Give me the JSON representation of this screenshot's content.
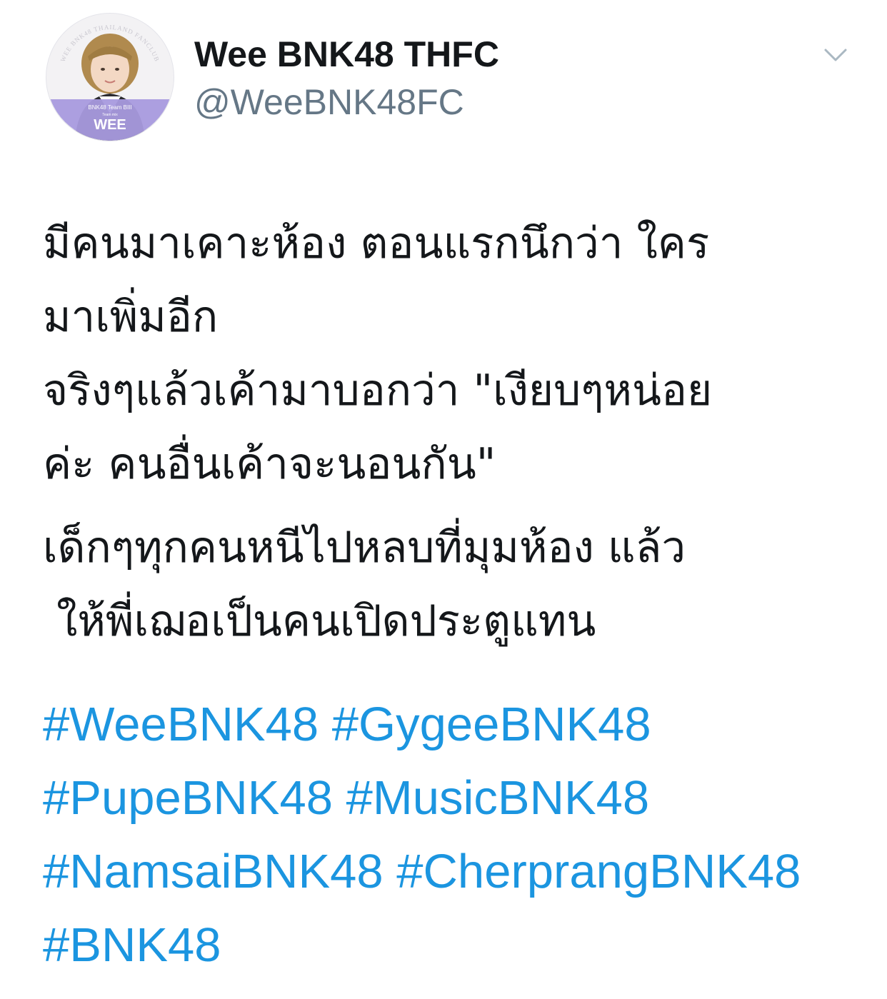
{
  "account": {
    "display_name": "Wee BNK48 THFC",
    "handle": "@WeeBNK48FC",
    "avatar": {
      "ring_text": "WEE BNK48 THAILAND FANCLUB",
      "badge_line1": "BNK48 Team BIII",
      "badge_line2": "Team mix",
      "badge_name": "WEE"
    },
    "menu_icon": "chevron-down-icon"
  },
  "tweet": {
    "paragraphs": [
      {
        "lines": [
          "มีคนมาเคาะห้อง ตอนแรกนึกว่า ใคร",
          "มาเพิ่มอีก",
          "จริงๆแล้วเค้ามาบอกว่า \"เงียบๆหน่อย",
          "ค่ะ คนอื่นเค้าจะนอนกัน\""
        ]
      },
      {
        "lines": [
          "เด็กๆทุกคนหนีไปหลบที่มุมห้อง แล้ว",
          " ให้พี่เฌอเป็นคนเปิดประตูแทน"
        ]
      }
    ],
    "hashtag_rows": [
      [
        "#WeeBNK48",
        "#GygeeBNK48"
      ],
      [
        "#PupeBNK48",
        "#MusicBNK48"
      ],
      [
        "#NamsaiBNK48",
        "#CherprangBNK48"
      ],
      [
        "#BNK48"
      ]
    ]
  },
  "colors": {
    "text": "#14171a",
    "secondary": "#657786",
    "link": "#1b95e0",
    "caret": "#aab8c2",
    "badge": "#9b8fd6"
  }
}
